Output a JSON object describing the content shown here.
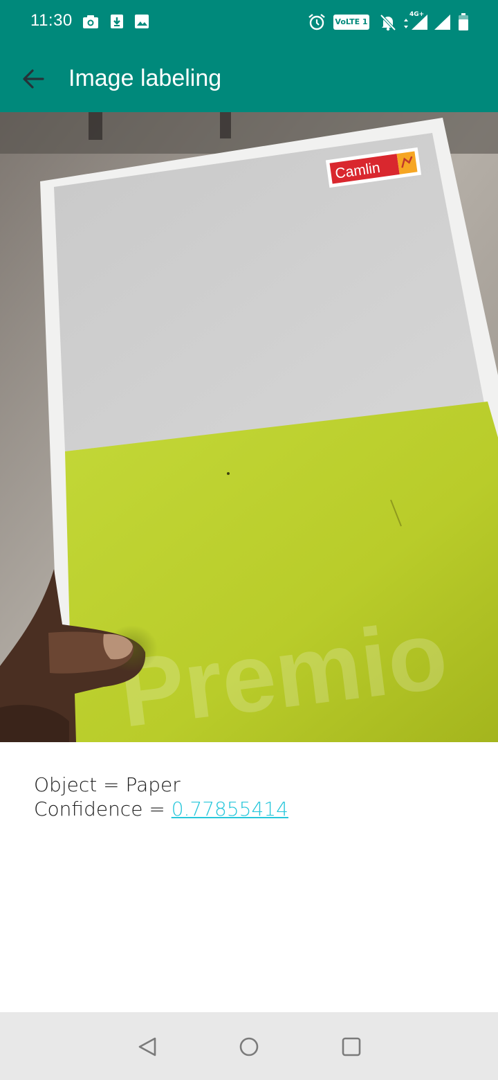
{
  "status_bar": {
    "time": "11:30",
    "volte": "VoLTE 1",
    "network": "4G+",
    "icons": [
      "camera-icon",
      "download-icon",
      "image-icon",
      "alarm-icon",
      "volte-icon",
      "bell-off-icon",
      "signal-4g-icon",
      "signal-icon",
      "battery-icon"
    ]
  },
  "app_bar": {
    "title": "Image labeling",
    "back_icon": "arrow-back-icon"
  },
  "photo": {
    "brand_label": "Camlin",
    "cover_text": "Premio"
  },
  "result": {
    "object_label": "Object = ",
    "object_value": "Paper",
    "confidence_label": "Confidence = ",
    "confidence_value": "0.77855414"
  },
  "nav_bar": {
    "icons": [
      "nav-back-icon",
      "nav-home-icon",
      "nav-recents-icon"
    ]
  },
  "colors": {
    "primary": "#00897b",
    "link": "#26c6da",
    "nav_background": "#e8e8e8"
  }
}
